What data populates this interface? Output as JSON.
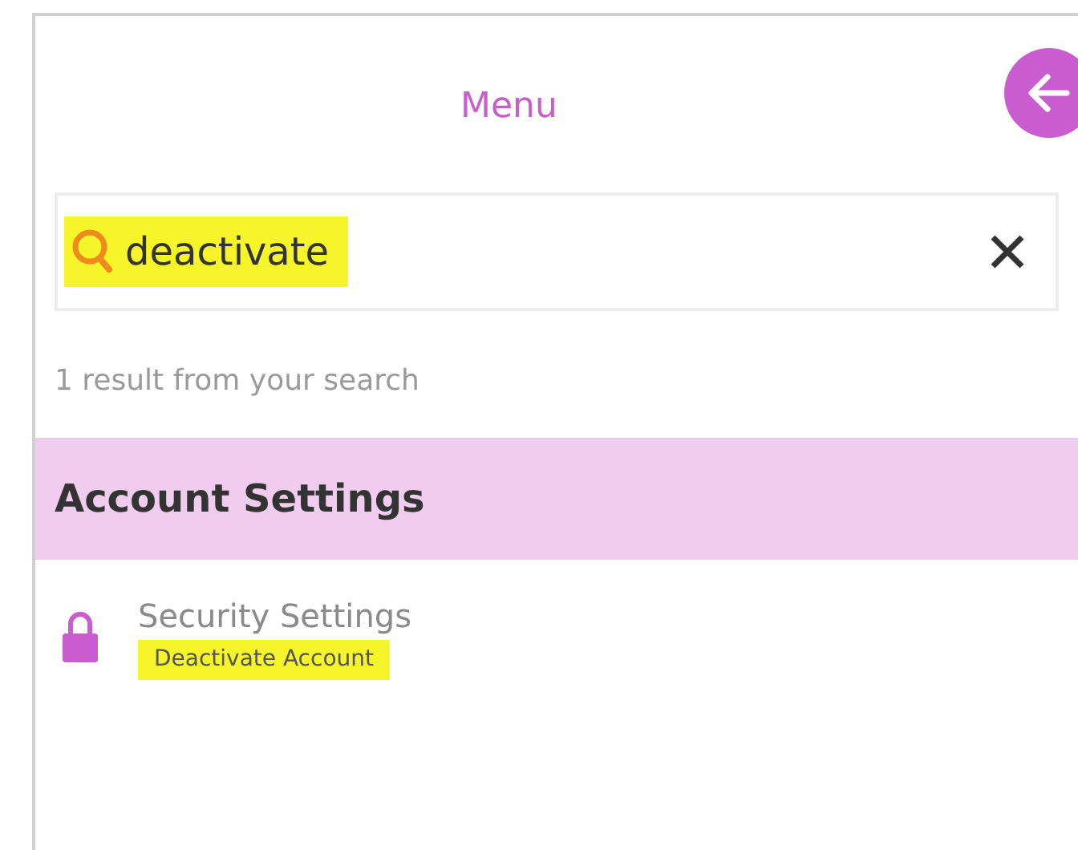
{
  "header": {
    "title": "Menu"
  },
  "search": {
    "value": "deactivate"
  },
  "result_count": "1 result from your search",
  "sections": [
    {
      "title": "Account Settings",
      "items": [
        {
          "title": "Security Settings",
          "match": "Deactivate Account"
        }
      ]
    }
  ]
}
